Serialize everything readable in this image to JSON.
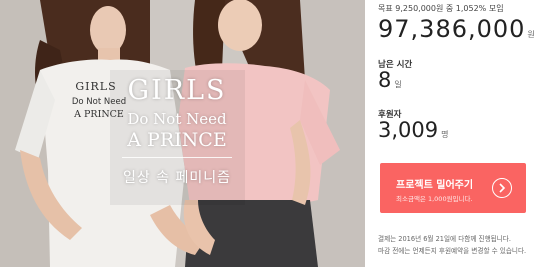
{
  "hero": {
    "overlay_title": "GIRLS",
    "overlay_line1": "Do Not Need",
    "overlay_line2": "A PRINCE",
    "overlay_subtitle": "일상 속 페미니즘",
    "shirt_print_line1": "GIRLS",
    "shirt_print_line2": "Do Not Need",
    "shirt_print_line3": "A PRINCE"
  },
  "funding": {
    "goal_text": "목표 9,250,000원 중 1,052% 모임",
    "raised_amount": "97,386,000",
    "raised_unit": "원",
    "time_left_label": "남은 시간",
    "time_left_value": "8",
    "time_left_unit": "일",
    "backers_label": "후원자",
    "backers_value": "3,009",
    "backers_unit": "명"
  },
  "cta": {
    "label": "프로젝트 밀어주기",
    "min_amount": "최소금액은 1,000원입니다.",
    "icon": "chevron-right-icon",
    "color": "#fa6462"
  },
  "notice": {
    "line1": "결제는 2016년 6월 21일에 다함께 진행됩니다.",
    "line2": "마감 전에는 언제든지 후원예약을 변경할 수 있습니다."
  }
}
